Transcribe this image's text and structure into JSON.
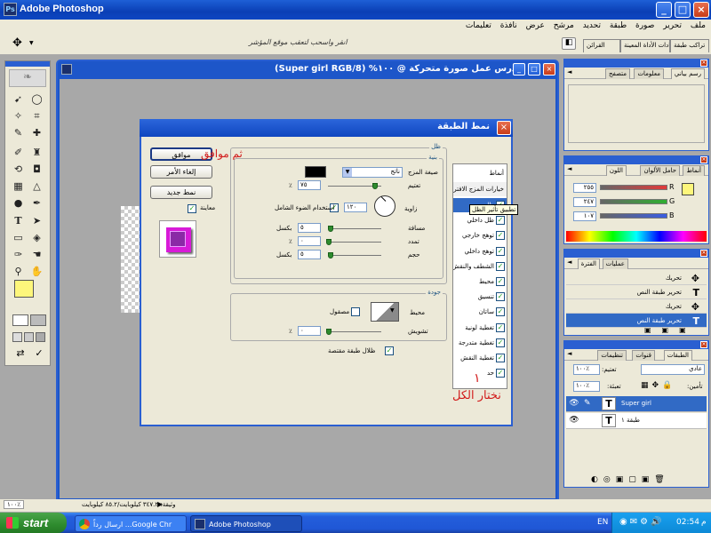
{
  "app": {
    "title": "Adobe Photoshop",
    "icon": "ps-icon"
  },
  "window_controls": {
    "minimize": "_",
    "maximize": "□",
    "close": "×"
  },
  "menu": [
    "ملف",
    "تحرير",
    "صورة",
    "طبقة",
    "تحديد",
    "مرشح",
    "عرض",
    "نافذة",
    "تعليمات"
  ],
  "options_bar": {
    "hint": "انقر واسحب لتعقب موقع المؤشر"
  },
  "palette_well_tabs": [
    "تراكب طبقة",
    "إعدادات الأداة المعينة",
    "القرائن"
  ],
  "document": {
    "title": "درس عمل صورة متحركة @ ١٠٠% (Super girl  RGB/8)"
  },
  "dialog": {
    "title": "نمط الطبقة",
    "close": "×",
    "buttons": {
      "ok": "موافق",
      "cancel": "إلغاء الأمر",
      "new_style": "نمط جديد"
    },
    "preview_label": "معاينة",
    "style_list": [
      {
        "label": "أنماط",
        "checked": null
      },
      {
        "label": "خيارات المزج الافتراضي",
        "checked": null
      },
      {
        "label": "ظل",
        "checked": true,
        "selected": true
      },
      {
        "label": "ظل داخلي",
        "checked": true
      },
      {
        "label": "توهج خارجي",
        "checked": true
      },
      {
        "label": "توهج داخلي",
        "checked": true
      },
      {
        "label": "الشطف والنقش",
        "checked": true
      },
      {
        "label": "محيط",
        "checked": true
      },
      {
        "label": "تنسيق",
        "checked": true
      },
      {
        "label": "ساتان",
        "checked": true
      },
      {
        "label": "تغطية لونية",
        "checked": true
      },
      {
        "label": "تغطية متدرجة",
        "checked": true
      },
      {
        "label": "تغطية النقش",
        "checked": true
      },
      {
        "label": "حد",
        "checked": true
      }
    ],
    "tooltip": "تطبيق تأثير الظل",
    "drop_shadow": {
      "section": "ظل",
      "structure": "بنية",
      "blend_mode_label": "صيغة المزج",
      "blend_mode": "ناتج",
      "opacity_label": "تعتيم",
      "opacity": "٧٥",
      "angle_label": "زاوية",
      "angle": "١٢٠",
      "global_light": "استخدام الضوء الشامل",
      "distance_label": "مسافة",
      "distance": "٥",
      "spread_label": "تمدد",
      "spread": "٠",
      "size_label": "حجم",
      "size": "٥",
      "unit": "بكسل",
      "percent": "٪",
      "quality": "جودة",
      "contour_label": "محيط",
      "anti_aliased": "مصقول",
      "noise_label": "تشويش",
      "noise": "٠",
      "knockout": "ظلال طبقة مقتصة"
    }
  },
  "annotations": {
    "ok_note": "ثم موافق",
    "choose_all": "نختار الكل",
    "number": "١"
  },
  "navigator_panel": {
    "tabs": [
      "رسم بياني",
      "معلومات",
      "متصفح"
    ]
  },
  "color_panel": {
    "tabs": [
      "أنماط",
      "حامل الألوان",
      "اللون"
    ],
    "channels": [
      {
        "label": "R",
        "value": "٢٥٥",
        "color": "#e23a3a"
      },
      {
        "label": "G",
        "value": "٢٤٧",
        "color": "#2fae2f"
      },
      {
        "label": "B",
        "value": "١٠٧",
        "color": "#3a5de2"
      }
    ],
    "foreground": "#fdf67b",
    "background": "#bd8a7d"
  },
  "history_panel": {
    "tabs": [
      "عمليات",
      "الفترة"
    ],
    "items": [
      {
        "label": "تحريك",
        "icon": "move-tool-icon",
        "selected": false
      },
      {
        "label": "تحرير طبقة النص",
        "icon": "type-icon",
        "selected": false
      },
      {
        "label": "تحريك",
        "icon": "move-tool-icon",
        "selected": false
      },
      {
        "label": "تحرير طبقة النص",
        "icon": "type-icon",
        "selected": true
      }
    ]
  },
  "layers_panel": {
    "tabs": [
      "تنظيمات",
      "قنوات",
      "الطبقات"
    ],
    "blend": "عادي",
    "opacity_label": "تعتيم:",
    "opacity": "١٠٠٪",
    "lock_label": "تأمين:",
    "fill_label": "تعبئة:",
    "fill": "١٠٠٪",
    "layers": [
      {
        "name": "Super girl",
        "selected": true
      },
      {
        "name": "طبقة ١",
        "selected": false
      }
    ]
  },
  "status_bar": {
    "zoom": "١٠٠٪",
    "doc_info": "وثيقة: ٣٤٧.٢ كيلوبايت/٨٥.٢ كيلوبايت"
  },
  "taskbar": {
    "start": "start",
    "tasks": [
      {
        "label": "ارسال رداً ...Google Chr",
        "icon": "chrome-icon"
      },
      {
        "label": "Adobe Photoshop",
        "icon": "ps-icon"
      }
    ],
    "lang": "EN",
    "clock": "02:54",
    "am_pm": "م"
  },
  "colors": {
    "xp_blue": "#1e5fd6",
    "accent_red": "#d21a1a",
    "selection": "#316ac5"
  }
}
